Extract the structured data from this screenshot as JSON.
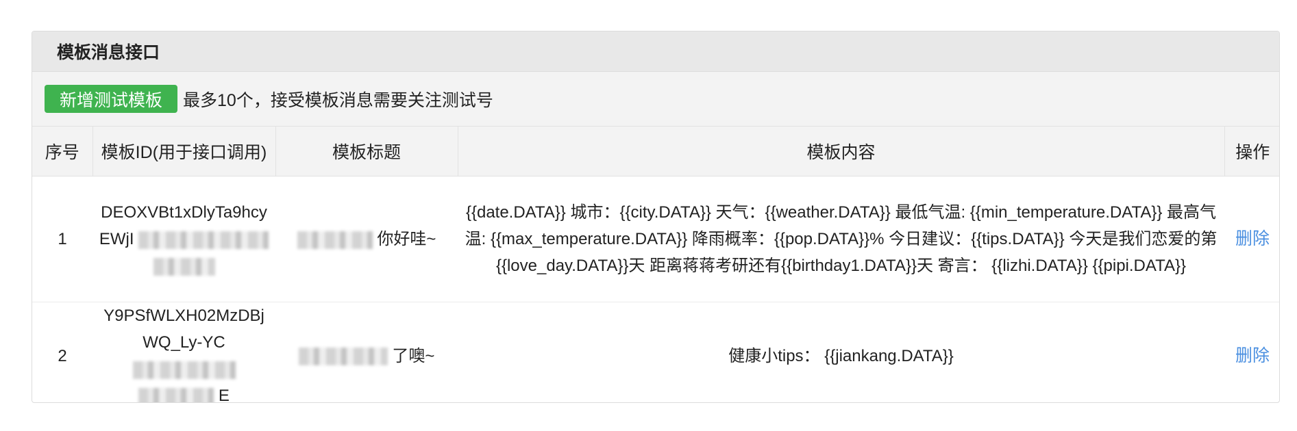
{
  "panel": {
    "title": "模板消息接口"
  },
  "toolbar": {
    "add_label": "新增测试模板",
    "note": "最多10个，接受模板消息需要关注测试号",
    "add_button_color": "#3fb34f"
  },
  "table": {
    "headers": [
      "序号",
      "模板ID(用于接口调用)",
      "模板标题",
      "模板内容",
      "操作"
    ],
    "rows": [
      {
        "index": "1",
        "id_line1": "DEOXVBt1xDlyTa9hcy",
        "id_line2_prefix": "EWjI",
        "id_line2_blur": true,
        "id_line3_suffix": "",
        "title_suffix": "你好哇~",
        "content": "{{date.DATA}} 城市：{{city.DATA}} 天气：{{weather.DATA}} 最低气温: {{min_temperature.DATA}} 最高气温: {{max_temperature.DATA}} 降雨概率：{{pop.DATA}}% 今日建议：{{tips.DATA}} 今天是我们恋爱的第{{love_day.DATA}}天 距离蒋蒋考研还有{{birthday1.DATA}}天 寄言： {{lizhi.DATA}} {{pipi.DATA}}",
        "action": "删除"
      },
      {
        "index": "2",
        "id_line1": "Y9PSfWLXH02MzDBj",
        "id_line2_prefix": "WQ_Ly-YC",
        "id_line2_blur": true,
        "id_line3_suffix": "E",
        "title_suffix": "了噢~",
        "content": "健康小tips： {{jiankang.DATA}}",
        "action": "删除"
      }
    ]
  },
  "colors": {
    "link": "#4a8fe0",
    "header_bg": "#e8e8e8"
  }
}
